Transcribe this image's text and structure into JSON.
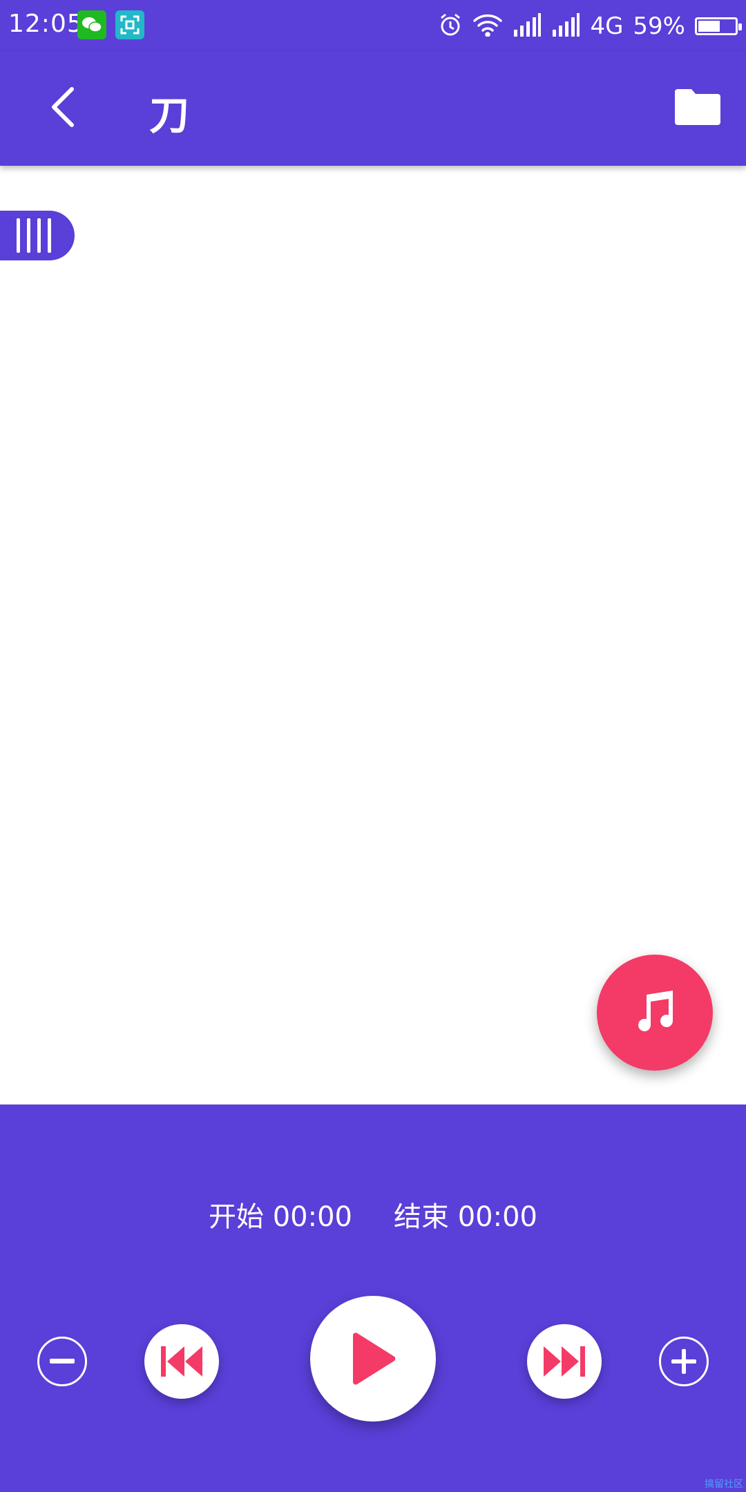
{
  "status_bar": {
    "time": "12:05",
    "network": "4G",
    "battery": "59%",
    "battery_level": 0.59,
    "notification_icons": [
      "wechat-icon",
      "scan-icon"
    ],
    "system_icons": [
      "alarm-icon",
      "wifi-icon",
      "signal-icon",
      "signal-icon"
    ]
  },
  "app_bar": {
    "title": "刀",
    "back_icon": "back-arrow-icon",
    "folder_icon": "folder-icon"
  },
  "player": {
    "start_label": "开始 00:00",
    "end_label": "结束 00:00",
    "controls": [
      "minus-icon",
      "skip-previous-icon",
      "play-icon",
      "skip-next-icon",
      "plus-icon"
    ]
  },
  "fab": {
    "icon": "music-note-icon"
  },
  "colors": {
    "primary": "#5a3fd8",
    "accent": "#f43a66",
    "surface": "#ffffff"
  },
  "watermark": "搞留社区"
}
